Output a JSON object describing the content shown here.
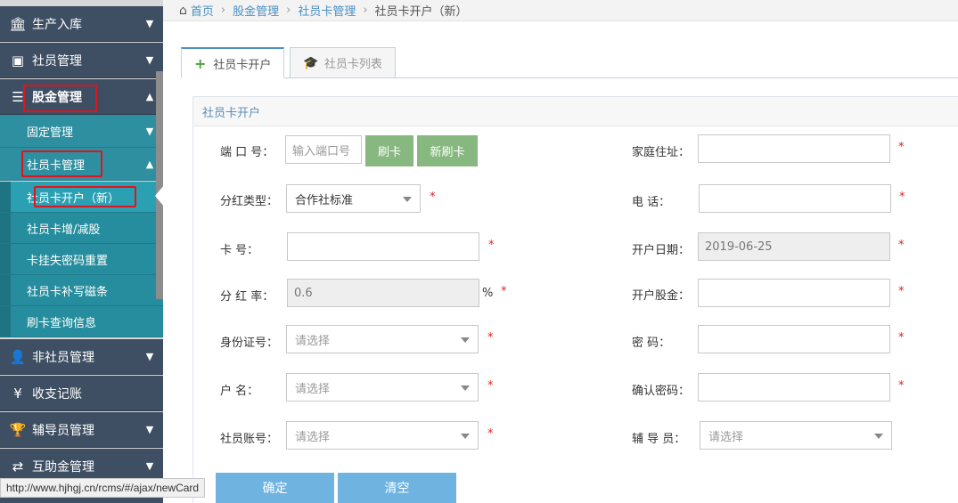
{
  "sidebar": {
    "items": [
      {
        "label": "生产入库",
        "icon": "bank-icon"
      },
      {
        "label": "社员管理",
        "icon": "picture-icon"
      },
      {
        "label": "股金管理",
        "icon": "database-icon"
      },
      {
        "label": "非社员管理",
        "icon": "person-icon"
      },
      {
        "label": "收支记账",
        "icon": "yen-icon"
      },
      {
        "label": "辅导员管理",
        "icon": "trophy-icon"
      },
      {
        "label": "互助金管理",
        "icon": "exchange-icon"
      }
    ],
    "subitems": [
      {
        "label": "固定管理"
      },
      {
        "label": "社员卡管理"
      }
    ],
    "leaves": [
      {
        "label": "社员卡开户（新）"
      },
      {
        "label": "社员卡增/减股"
      },
      {
        "label": "卡挂失密码重置"
      },
      {
        "label": "社员卡补写磁条"
      },
      {
        "label": "刷卡查询信息"
      }
    ]
  },
  "breadcrumb": {
    "home": "首页",
    "level1": "股金管理",
    "level2": "社员卡管理",
    "current": "社员卡开户（新）"
  },
  "tabs": [
    {
      "label": "社员卡开户"
    },
    {
      "label": "社员卡列表"
    }
  ],
  "panel": {
    "title": "社员卡开户"
  },
  "form": {
    "port": {
      "label": "端 口 号：",
      "placeholder": "输入端口号"
    },
    "swipe_button": "刷卡",
    "new_swipe_button": "新刷卡",
    "dividend_type": {
      "label": "分红类型：",
      "value": "合作社标准"
    },
    "card_no": {
      "label": "卡      号："
    },
    "dividend_rate": {
      "label": "分 红 率：",
      "value": "0.6",
      "unit": "%"
    },
    "id_no": {
      "label": "身份证号：",
      "placeholder": "请选择"
    },
    "account_name": {
      "label": "户      名：",
      "placeholder": "请选择"
    },
    "member_account": {
      "label": "社员账号：",
      "placeholder": "请选择"
    },
    "address": {
      "label": "家庭住址："
    },
    "phone": {
      "label": "电      话："
    },
    "open_date": {
      "label": "开户日期：",
      "value": "2019-06-25"
    },
    "open_share": {
      "label": "开户股金："
    },
    "password": {
      "label": "密      码："
    },
    "confirm_password": {
      "label": "确认密码："
    },
    "counselor": {
      "label": "辅 导 员：",
      "placeholder": "请选择"
    },
    "required_mark": "*",
    "confirm_button": "确定",
    "clear_button": "清空"
  },
  "statusbar": {
    "url": "http://www.hjhgj.cn/rcms/#/ajax/newCard"
  }
}
